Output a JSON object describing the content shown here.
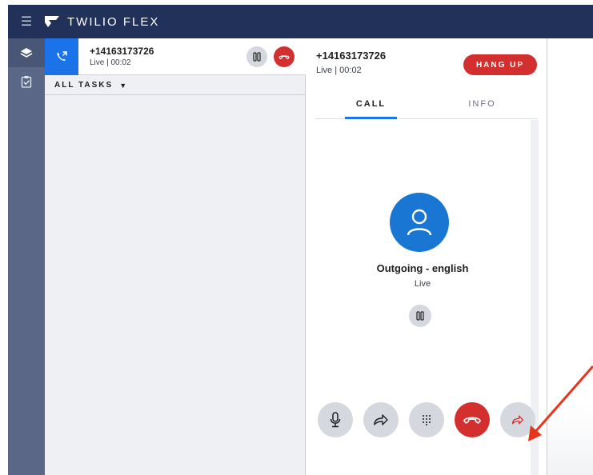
{
  "header": {
    "brand_name": "TWILIO FLEX",
    "colors": {
      "background": "#22315a",
      "text": "#ffffff"
    }
  },
  "sidebar": {
    "items": [
      {
        "icon": "layers-icon",
        "active": true
      },
      {
        "icon": "clipboard-check-icon",
        "active": false
      }
    ]
  },
  "task_list": {
    "task": {
      "number": "+14163173726",
      "status": "Live | 00:02",
      "icon": "outbound-call-icon"
    },
    "filter_label": "ALL TASKS"
  },
  "call_panel": {
    "number": "+14163173726",
    "status": "Live | 00:02",
    "hangup_label": "HANG UP",
    "tabs": [
      {
        "label": "CALL",
        "active": true
      },
      {
        "label": "INFO",
        "active": false
      }
    ],
    "caller_name": "Outgoing - english",
    "caller_status": "Live"
  },
  "controls": [
    {
      "name": "mute",
      "icon": "microphone-icon"
    },
    {
      "name": "transfer",
      "icon": "forward-arrow-icon"
    },
    {
      "name": "dialpad",
      "icon": "dialpad-icon"
    },
    {
      "name": "hangup",
      "icon": "phone-hangup-icon"
    },
    {
      "name": "custom-transfer",
      "icon": "forward-arrow-red-icon"
    }
  ],
  "colors": {
    "accent_blue": "#1a73e8",
    "danger_red": "#d32f2f",
    "annotation_arrow": "#e8341c"
  }
}
